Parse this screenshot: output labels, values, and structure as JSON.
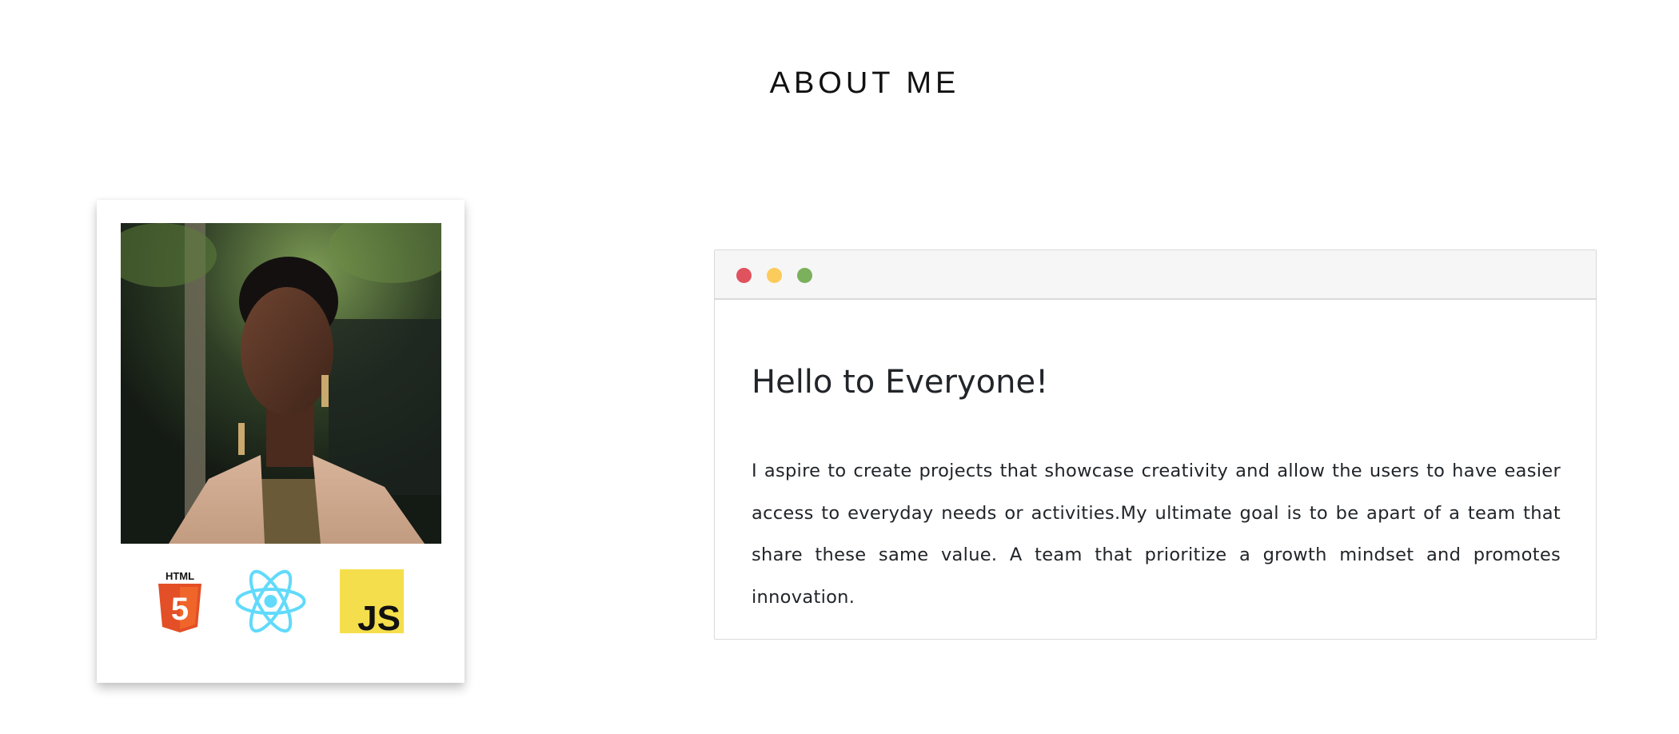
{
  "section": {
    "title": "ABOUT ME"
  },
  "profile": {
    "photo_alt": "Portrait photo",
    "skills": [
      {
        "label": "HTML",
        "glyph": "5",
        "icon": "html5-icon",
        "color": "#e34f26"
      },
      {
        "label": "React",
        "icon": "react-icon",
        "color": "#61dafb"
      },
      {
        "label": "JS",
        "icon": "javascript-icon",
        "color": "#f5de4b"
      }
    ]
  },
  "window": {
    "controls": {
      "close_color": "#e0525e",
      "minimize_color": "#fbcb5b",
      "maximize_color": "#7bb05c"
    },
    "heading": "Hello to Everyone!",
    "body": "I aspire to create projects that showcase creativity and allow the users to have easier access to everyday needs or activities.My ultimate goal is to be apart of a team that share these same value. A team that prioritize a growth mindset and promotes innovation."
  }
}
